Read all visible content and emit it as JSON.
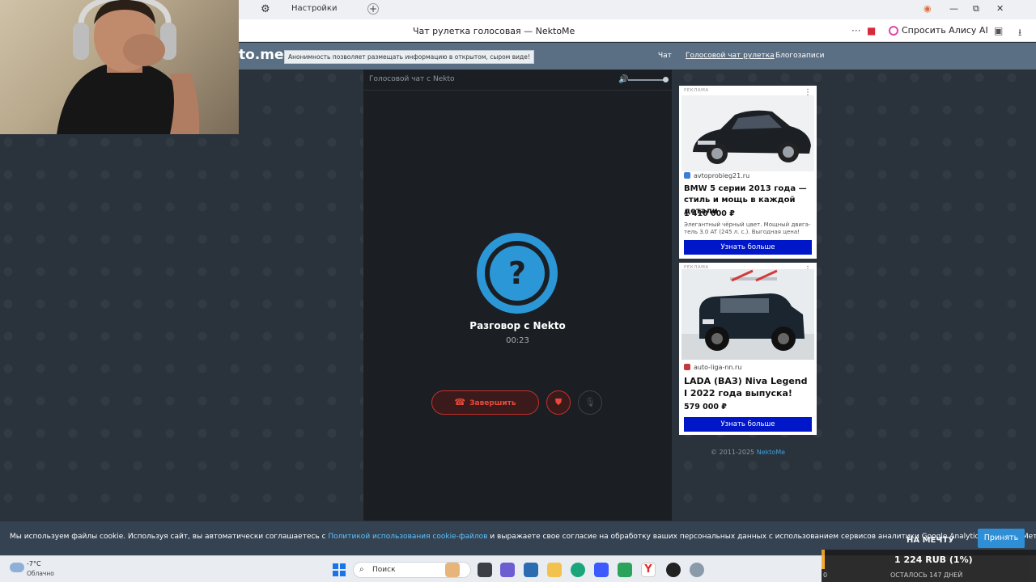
{
  "browser": {
    "tab_title": "Настройки",
    "new_tab": "+",
    "page_title": "Чат рулетка голосовая — NektoMe",
    "alice_label": "Спросить Алису AI",
    "more": "···",
    "win_min": "—",
    "win_max": "⧉",
    "win_close": "✕"
  },
  "site": {
    "logo": "to.me",
    "anon_note": "Анонимность позволяет размещать информацию в открытом, сыром виде!",
    "nav": [
      "Чат",
      "Голосовой чат рулетка",
      "Блогозаписи"
    ]
  },
  "chat": {
    "header_title": "Голосовой чат с Nekto",
    "avatar_glyph": "?",
    "conversation_title": "Разговор с Nekto",
    "timer": "00:23",
    "end_label": "Завершить"
  },
  "ads": [
    {
      "label": "РЕКЛАМА",
      "domain": "avtoprobieg21.ru",
      "title": "BMW 5 серии 2013 года — стиль и мощь в каждой детали",
      "price": "1 410 000 ₽",
      "desc": "Элегантный чёрный цвет. Мощный двига-тель 3.0 AT (245 л. с.). Выгодная цена!",
      "button": "Узнать больше"
    },
    {
      "label": "РЕКЛАМА",
      "domain": "auto-liga-nn.ru",
      "title": "LADA (ВАЗ) Niva Legend I 2022 года выпуска!",
      "price": "579 000 ₽",
      "button": "Узнать больше"
    }
  ],
  "copyright": {
    "text": "© 2011-2025 ",
    "link": "NektoMe"
  },
  "cookie": {
    "text_before": "Мы используем файлы cookie. Используя сайт, вы автоматически соглашаетесь с ",
    "link": "Политикой использования cookie-файлов",
    "text_after": " и выражаете свое согласие на обработку ваших персональных данных с использованием сервисов аналитики Google Analytics и Яндекс.Метрика.",
    "accept": "Принять"
  },
  "taskbar": {
    "temp": "-7°C",
    "condition": "Облачно",
    "search_placeholder": "Поиск"
  },
  "donation": {
    "title": "НА МЕЧТУ",
    "amount": "1 224 RUB (1%)",
    "left": "0",
    "remaining": "ОСТАЛОСЬ 147 ДНЕЙ"
  },
  "colors": {
    "accent": "#2c97d6",
    "danger": "#e84a3d",
    "ad_button": "#0016c9",
    "header": "#5a6f84"
  }
}
